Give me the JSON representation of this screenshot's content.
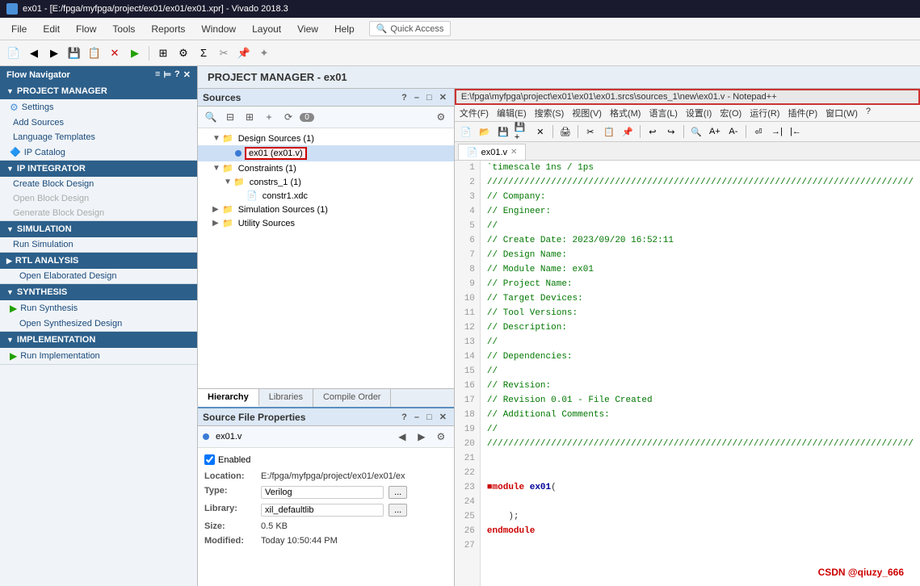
{
  "titleBar": {
    "icon": "vivado-icon",
    "title": "ex01 - [E:/fpga/myfpga/project/ex01/ex01/ex01.xpr] - Vivado 2018.3"
  },
  "menuBar": {
    "items": [
      "File",
      "Edit",
      "Flow",
      "Tools",
      "Reports",
      "Window",
      "Layout",
      "View",
      "Help"
    ],
    "quickAccess": "Quick Access"
  },
  "flowNav": {
    "header": "Flow Navigator",
    "sections": [
      {
        "name": "PROJECT MANAGER",
        "items": [
          {
            "label": "Settings",
            "icon": "gear",
            "disabled": false
          },
          {
            "label": "Add Sources",
            "disabled": false
          },
          {
            "label": "Language Templates",
            "disabled": false
          },
          {
            "label": "IP Catalog",
            "icon": "ip",
            "disabled": false
          }
        ]
      },
      {
        "name": "IP INTEGRATOR",
        "items": [
          {
            "label": "Create Block Design",
            "disabled": false
          },
          {
            "label": "Open Block Design",
            "disabled": false
          },
          {
            "label": "Generate Block Design",
            "disabled": false
          }
        ]
      },
      {
        "name": "SIMULATION",
        "items": [
          {
            "label": "Run Simulation",
            "disabled": false
          }
        ]
      },
      {
        "name": "RTL ANALYSIS",
        "items": [
          {
            "label": "Open Elaborated Design",
            "disabled": false
          }
        ]
      },
      {
        "name": "SYNTHESIS",
        "items": [
          {
            "label": "Run Synthesis",
            "icon": "play",
            "disabled": false
          },
          {
            "label": "Open Synthesized Design",
            "disabled": false
          }
        ]
      },
      {
        "name": "IMPLEMENTATION",
        "items": [
          {
            "label": "Run Implementation",
            "icon": "play",
            "disabled": false
          }
        ]
      }
    ]
  },
  "projectManager": {
    "title": "PROJECT MANAGER - ex01"
  },
  "sourcesPanel": {
    "title": "Sources",
    "badge": "0",
    "tabs": [
      "Hierarchy",
      "Libraries",
      "Compile Order"
    ],
    "activeTab": "Hierarchy",
    "tree": {
      "designSources": {
        "label": "Design Sources",
        "count": "1",
        "children": [
          {
            "label": "ex01 (ex01.v)",
            "highlighted": true,
            "dot": "blue"
          }
        ]
      },
      "constraints": {
        "label": "Constraints",
        "count": "1",
        "children": [
          {
            "label": "constrs_1 (1)",
            "children": [
              {
                "label": "constr1.xdc",
                "isFile": true
              }
            ]
          }
        ]
      },
      "simulationSources": {
        "label": "Simulation Sources",
        "count": "1"
      },
      "utilitySources": {
        "label": "Utility Sources"
      }
    }
  },
  "fileProperties": {
    "title": "Source File Properties",
    "fileName": "ex01.v",
    "dot": "blue",
    "enabled": true,
    "location": "E:/fpga/myfpga/project/ex01/ex01/ex",
    "type": "Verilog",
    "library": "xil_defaultlib",
    "size": "0.5 KB",
    "modified": "Today 10:50:44 PM",
    "labels": {
      "enabled": "Enabled",
      "location": "Location:",
      "type": "Type:",
      "library": "Library:",
      "size": "Size:",
      "modified": "Modified:"
    }
  },
  "notepadHeader": {
    "title": "E:\\fpga\\myfpga\\project\\ex01\\ex01\\ex01.srcs\\sources_1\\new\\ex01.v - Notepad++"
  },
  "notepadMenu": {
    "items": [
      "文件(F)",
      "编辑(E)",
      "搜索(S)",
      "视图(V)",
      "格式(M)",
      "语言(L)",
      "设置(I)",
      "宏(O)",
      "运行(R)",
      "插件(P)",
      "窗口(W)",
      "?"
    ]
  },
  "editorTabs": [
    {
      "label": "ex01.v",
      "active": true
    }
  ],
  "codeLines": [
    {
      "num": 1,
      "text": "`timescale 1ns / 1ps",
      "type": "timescale"
    },
    {
      "num": 2,
      "text": "////////////////////////////////////////////////////////////////////////////////",
      "type": "comment"
    },
    {
      "num": 3,
      "text": "// Company:",
      "type": "comment"
    },
    {
      "num": 4,
      "text": "// Engineer:",
      "type": "comment"
    },
    {
      "num": 5,
      "text": "//",
      "type": "comment"
    },
    {
      "num": 6,
      "text": "// Create Date: 2023/09/20 16:52:11",
      "type": "comment"
    },
    {
      "num": 7,
      "text": "// Design Name:",
      "type": "comment"
    },
    {
      "num": 8,
      "text": "// Module Name: ex01",
      "type": "comment"
    },
    {
      "num": 9,
      "text": "// Project Name:",
      "type": "comment"
    },
    {
      "num": 10,
      "text": "// Target Devices:",
      "type": "comment"
    },
    {
      "num": 11,
      "text": "// Tool Versions:",
      "type": "comment"
    },
    {
      "num": 12,
      "text": "// Description:",
      "type": "comment"
    },
    {
      "num": 13,
      "text": "//",
      "type": "comment"
    },
    {
      "num": 14,
      "text": "// Dependencies:",
      "type": "comment"
    },
    {
      "num": 15,
      "text": "//",
      "type": "comment"
    },
    {
      "num": 16,
      "text": "// Revision:",
      "type": "comment"
    },
    {
      "num": 17,
      "text": "// Revision 0.01 - File Created",
      "type": "comment"
    },
    {
      "num": 18,
      "text": "// Additional Comments:",
      "type": "comment"
    },
    {
      "num": 19,
      "text": "//",
      "type": "comment"
    },
    {
      "num": 20,
      "text": "////////////////////////////////////////////////////////////////////////////////",
      "type": "comment"
    },
    {
      "num": 21,
      "text": "",
      "type": "normal"
    },
    {
      "num": 22,
      "text": "",
      "type": "normal"
    },
    {
      "num": 23,
      "text": "module ex01(",
      "type": "module"
    },
    {
      "num": 24,
      "text": "",
      "type": "normal"
    },
    {
      "num": 25,
      "text": "    );",
      "type": "normal"
    },
    {
      "num": 26,
      "text": "endmodule",
      "type": "endmodule"
    },
    {
      "num": 27,
      "text": "",
      "type": "normal"
    }
  ],
  "watermark": "CSDN @qiuzy_666"
}
